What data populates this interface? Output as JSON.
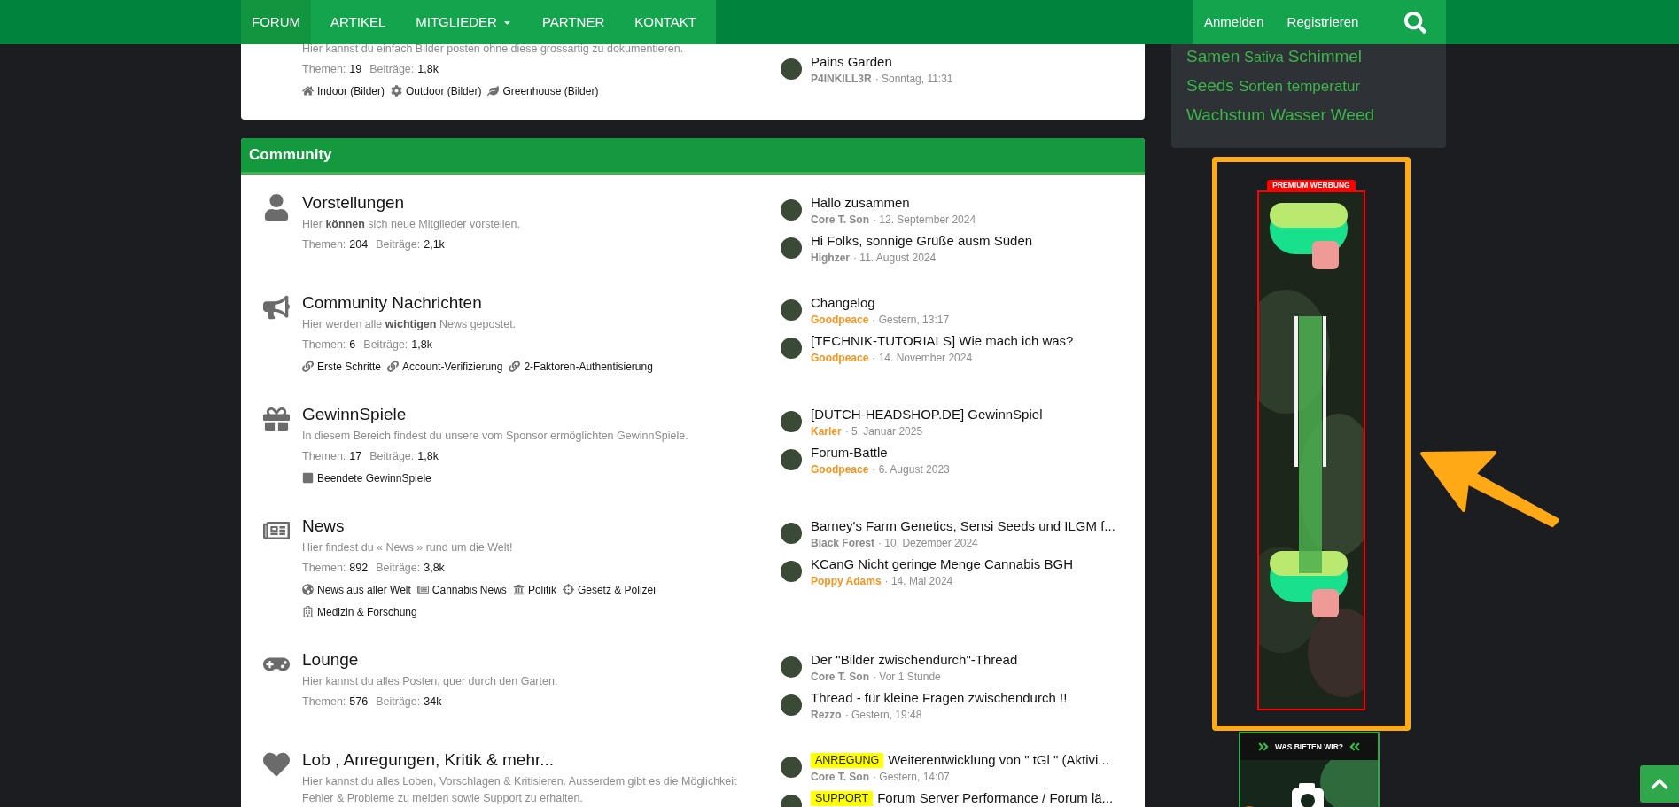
{
  "nav": {
    "items": [
      {
        "label": "FORUM",
        "selected": true,
        "dropdown": false
      },
      {
        "label": "ARTIKEL",
        "selected": false,
        "dropdown": false
      },
      {
        "label": "MITGLIEDER",
        "selected": false,
        "dropdown": true
      },
      {
        "label": "PARTNER",
        "selected": false,
        "dropdown": false
      },
      {
        "label": "KONTAKT",
        "selected": false,
        "dropdown": false
      }
    ],
    "account": [
      "Anmelden",
      "Registrieren"
    ]
  },
  "top_forum": {
    "description": "Hier kannst du einfach Bilder posten ohne diese grossartig zu dokumentieren.",
    "stats": [
      {
        "label": "Themen:",
        "value": "19"
      },
      {
        "label": "Beiträge:",
        "value": "1,8k"
      }
    ],
    "subforums": [
      {
        "kind": "house",
        "label": "Indoor (Bilder)"
      },
      {
        "kind": "gear",
        "label": "Outdoor (Bilder)"
      },
      {
        "kind": "leaf",
        "label": "Greenhouse (Bilder)"
      }
    ],
    "last_posts": [
      {
        "title": "Pains Garden",
        "user": "P4INKILL3R",
        "color": "#8a8a8a",
        "date": "· Sonntag, 11:31"
      }
    ]
  },
  "category": {
    "title": "Community",
    "forums": [
      {
        "kind": "user",
        "title": "Vorstellungen",
        "description": "Hier **können** sich neue Mitglieder vorstellen.",
        "stats": [
          {
            "label": "Themen:",
            "value": "204"
          },
          {
            "label": "Beiträge:",
            "value": "2,1k"
          }
        ],
        "last_posts": [
          {
            "title": "Hallo zusammen",
            "user": "Core T. Son",
            "color": "#8a8a8a",
            "date": "· 12. September 2024"
          },
          {
            "title": "Hi Folks, sonnige Grüße ausm Süden",
            "user": "Highzer",
            "color": "#8a8a8a",
            "date": "· 11. August 2024"
          }
        ]
      },
      {
        "kind": "megaphone",
        "title": "Community Nachrichten",
        "description": "Hier werden alle **wichtigen** News gepostet.",
        "stats": [
          {
            "label": "Themen:",
            "value": "6"
          },
          {
            "label": "Beiträge:",
            "value": "1,8k"
          }
        ],
        "subforums": [
          {
            "kind": "link",
            "label": "Erste Schritte"
          },
          {
            "kind": "link",
            "label": "Account-Verifizierung"
          },
          {
            "kind": "link",
            "label": "2-Faktoren-Authentisierung"
          }
        ],
        "last_posts": [
          {
            "title": "Changelog",
            "user": "Goodpeace",
            "color": "#f7931e",
            "date": "· Gestern, 13:17"
          },
          {
            "title": "[TECHNIK-TUTORIALS] Wie mach ich was?",
            "user": "Goodpeace",
            "color": "#f7931e",
            "date": "· 14. November 2024"
          }
        ]
      },
      {
        "kind": "gift",
        "title": "GewinnSpiele",
        "description": "In diesem Bereich findest du unsere vom Sponsor ermöglichten GewinnSpiele.",
        "stats": [
          {
            "label": "Themen:",
            "value": "17"
          },
          {
            "label": "Beiträge:",
            "value": "1,8k"
          }
        ],
        "subforums": [
          {
            "kind": "square",
            "label": "Beendete GewinnSpiele"
          }
        ],
        "last_posts": [
          {
            "title": "[DUTCH-HEADSHOP.DE] GewinnSpiel",
            "user": "Karler",
            "color": "#f7931e",
            "date": "· 5. Januar 2025"
          },
          {
            "title": "Forum-Battle",
            "user": "Goodpeace",
            "color": "#f7931e",
            "date": "· 6. August 2023"
          }
        ]
      },
      {
        "kind": "newspaper",
        "title": "News",
        "description": "Hier findest du « News » rund um die Welt!",
        "stats": [
          {
            "label": "Themen:",
            "value": "892"
          },
          {
            "label": "Beiträge:",
            "value": "3,8k"
          }
        ],
        "subforums": [
          {
            "kind": "globe",
            "label": "News aus aller Welt"
          },
          {
            "kind": "newspaper",
            "label": "Cannabis News"
          },
          {
            "kind": "landmark",
            "label": "Politik"
          },
          {
            "kind": "crosshair",
            "label": "Gesetz & Polizei"
          },
          {
            "kind": "hospital",
            "label": "Medizin & Forschung"
          }
        ],
        "last_posts": [
          {
            "title": "Barney's Farm Genetics, Sensi Seeds und ILGM f...",
            "user": "Black Forest",
            "color": "#8a8a8a",
            "date": "· 10. Dezember 2024"
          },
          {
            "title": "KCanG Nicht geringe Menge Cannabis BGH",
            "user": "Poppy Adams",
            "color": "#f7931e",
            "date": "· 14. Mai 2024"
          }
        ]
      },
      {
        "kind": "gamepad",
        "title": "Lounge",
        "description": "Hier kannst du alles Posten, quer durch den Garten.",
        "stats": [
          {
            "label": "Themen:",
            "value": "576"
          },
          {
            "label": "Beiträge:",
            "value": "34k"
          }
        ],
        "last_posts": [
          {
            "title": "Der \"Bilder zwischendurch\"-Thread",
            "user": "Core T. Son",
            "color": "#8a8a8a",
            "date": "· Vor 1 Stunde"
          },
          {
            "title": "Thread - für kleine Fragen zwischendurch !!",
            "user": "Rezzo",
            "color": "#8a8a8a",
            "date": "· Gestern, 19:48"
          }
        ]
      },
      {
        "kind": "heart",
        "title": "Lob , Anregungen, Kritik & mehr...",
        "description": "Hier kannst du alles Loben, Vorschlagen & Kritisieren. Ausserdem gibt es die Möglichkeit Fehler & Probleme zu melden sowie Support zu erhalten.",
        "last_posts": [
          {
            "prefix": "ANREGUNG",
            "title": "Weiterentwicklung von \" tGl \" (Aktivi...",
            "user": "Core T. Son",
            "color": "#8a8a8a",
            "date": "· Gestern, 14:07"
          },
          {
            "prefix": "SUPPORT",
            "title": "Forum Server Performance / Forum lä..."
          }
        ]
      }
    ]
  },
  "tag_cloud": [
    [
      {
        "label": "Samen",
        "kind": "large"
      },
      {
        "label": "Sativa",
        "kind": "small"
      },
      {
        "label": "Schimmel",
        "kind": "large"
      }
    ],
    [
      {
        "label": "Seeds",
        "kind": "large"
      },
      {
        "label": "Sorten",
        "kind": "medium"
      },
      {
        "label": "temperatur",
        "kind": "medium"
      }
    ],
    [
      {
        "label": "Wachstum",
        "kind": "large"
      },
      {
        "label": "Wasser",
        "kind": "large"
      },
      {
        "label": "Weed",
        "kind": "large"
      }
    ]
  ],
  "ad": {
    "label": "PREMIUM WERBUNG"
  },
  "ad2": {
    "title": "WAS BIETEN WIR?"
  }
}
